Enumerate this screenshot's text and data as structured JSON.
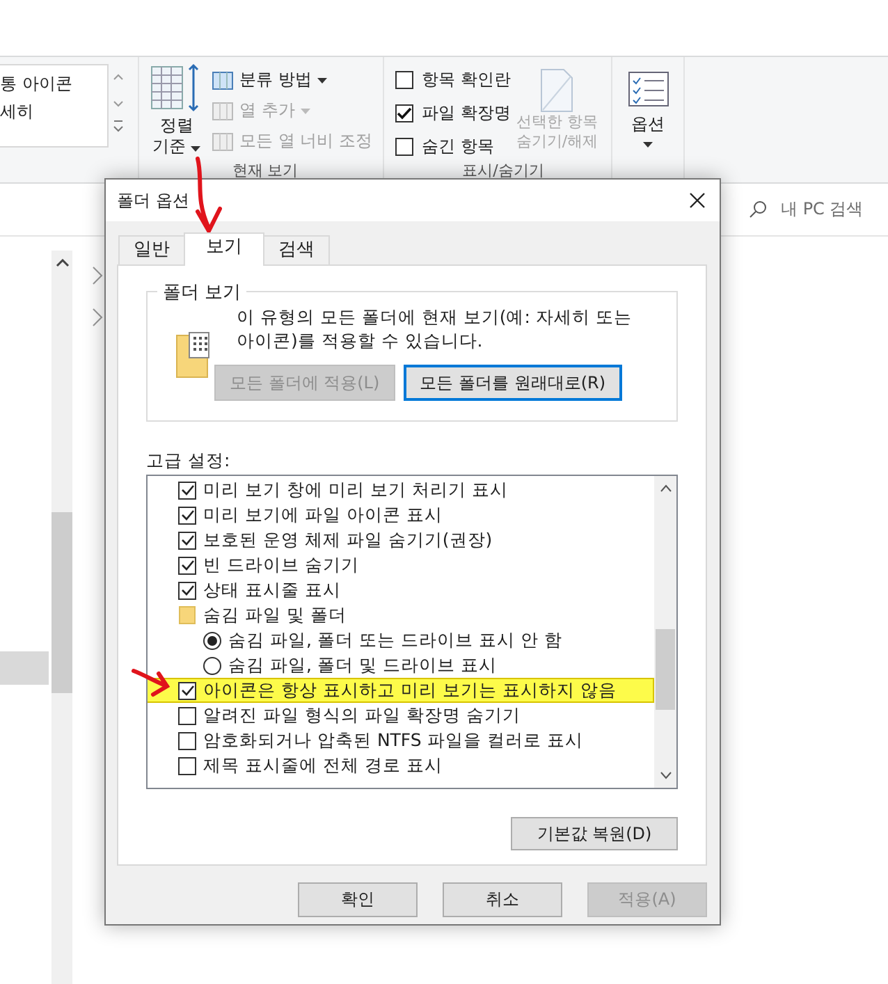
{
  "ribbon": {
    "layout_items": [
      {
        "label": "통 아이콘"
      },
      {
        "label": "세히"
      }
    ],
    "current_view": {
      "sort_lines": [
        "정렬",
        "기준"
      ],
      "commands": [
        {
          "label": "분류 방법",
          "disabled": false,
          "dropdown": true
        },
        {
          "label": "열 추가",
          "disabled": true,
          "dropdown": true
        },
        {
          "label": "모든 열 너비 조정",
          "disabled": true,
          "dropdown": false
        }
      ],
      "group_label": "현재 보기"
    },
    "show_hide": {
      "checkboxes": [
        {
          "label": "항목 확인란",
          "checked": false
        },
        {
          "label": "파일 확장명",
          "checked": true
        },
        {
          "label": "숨긴 항목",
          "checked": false
        }
      ],
      "hide_selected": {
        "lines": [
          "선택한 항목",
          "숨기기/해제"
        ],
        "disabled": true
      },
      "group_label": "표시/숨기기"
    },
    "options": {
      "label": "옵션"
    }
  },
  "search": {
    "placeholder": "내 PC 검색"
  },
  "dialog": {
    "title": "폴더 옵션",
    "tabs": [
      {
        "label": "일반",
        "selected": false
      },
      {
        "label": "보기",
        "selected": true
      },
      {
        "label": "검색",
        "selected": false
      }
    ],
    "folder_views": {
      "legend": "폴더 보기",
      "description": "이 유형의 모든 폴더에 현재 보기(예: 자세히 또는 아이콘)를 적용할 수 있습니다.",
      "buttons": [
        {
          "label": "모든 폴더에 적용(L)",
          "disabled": true,
          "focused": false
        },
        {
          "label": "모든 폴더를 원래대로(R)",
          "disabled": false,
          "focused": true
        }
      ]
    },
    "advanced_label": "고급 설정:",
    "settings": [
      {
        "kind": "checkbox",
        "label": "미리 보기 창에 미리 보기 처리기 표시",
        "checked": true,
        "highlighted": false
      },
      {
        "kind": "checkbox",
        "label": "미리 보기에 파일 아이콘 표시",
        "checked": true,
        "highlighted": false
      },
      {
        "kind": "checkbox",
        "label": "보호된 운영 체제 파일 숨기기(권장)",
        "checked": true,
        "highlighted": false
      },
      {
        "kind": "checkbox",
        "label": "빈 드라이브 숨기기",
        "checked": true,
        "highlighted": false
      },
      {
        "kind": "checkbox",
        "label": "상태 표시줄 표시",
        "checked": true,
        "highlighted": false
      },
      {
        "kind": "folder",
        "label": "숨김 파일 및 폴더",
        "highlighted": false
      },
      {
        "kind": "radio",
        "label": "숨김 파일, 폴더 또는 드라이브 표시 안 함",
        "selected": true,
        "highlighted": false
      },
      {
        "kind": "radio",
        "label": "숨김 파일, 폴더 및 드라이브 표시",
        "selected": false,
        "highlighted": false
      },
      {
        "kind": "checkbox",
        "label": "아이콘은 항상 표시하고 미리 보기는 표시하지 않음",
        "checked": true,
        "highlighted": true
      },
      {
        "kind": "checkbox",
        "label": "알려진 파일 형식의 파일 확장명 숨기기",
        "checked": false,
        "highlighted": false
      },
      {
        "kind": "checkbox",
        "label": "암호화되거나 압축된 NTFS 파일을 컬러로 표시",
        "checked": false,
        "highlighted": false
      },
      {
        "kind": "checkbox",
        "label": "제목 표시줄에 전체 경로 표시",
        "checked": false,
        "highlighted": false
      }
    ],
    "restore_button": "기본값 복원(D)",
    "buttons": [
      {
        "label": "확인",
        "disabled": false
      },
      {
        "label": "취소",
        "disabled": false
      },
      {
        "label": "적용(A)",
        "disabled": true
      }
    ]
  }
}
